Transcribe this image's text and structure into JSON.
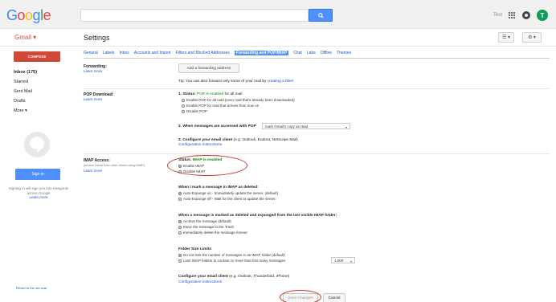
{
  "topbar": {
    "logo": [
      "G",
      "o",
      "o",
      "g",
      "l",
      "e"
    ],
    "logo_colors": [
      "#4285f4",
      "#ea4335",
      "#fbbc05",
      "#4285f4",
      "#34a853",
      "#ea4335"
    ],
    "user_text": "Test",
    "avatar_initial": "T"
  },
  "subbar": {
    "gmail_label": "Gmail ▾",
    "page_title": "Settings",
    "density_icon": "☰ ▾",
    "gear_icon": "⚙ ▾"
  },
  "sidebar": {
    "compose_label": "COMPOSE",
    "items": [
      "Inbox (175)",
      "Starred",
      "Sent Mail",
      "Drafts",
      "More ▾"
    ],
    "signin_label": "Sign in",
    "hangout_note": "Signing in will sign you into Hangouts across Google",
    "learn_more": "Learn more",
    "revert_link": "Revert to the old chat"
  },
  "tabs": [
    "General",
    "Labels",
    "Inbox",
    "Accounts and Import",
    "Filters and Blocked Addresses",
    "Forwarding and POP/IMAP",
    "Chat",
    "Labs",
    "Offline",
    "Themes"
  ],
  "active_tab_index": 5,
  "forwarding": {
    "label": "Forwarding:",
    "learn_more": "Learn more",
    "add_button": "Add a forwarding address",
    "tip_prefix": "Tip: You can also forward only some of your mail by",
    "tip_link": "creating a filter!"
  },
  "pop": {
    "label": "POP Download:",
    "learn_more": "Learn more",
    "status_prefix": "1. Status:",
    "status_value": "POP is enabled",
    "status_suffix": "for all mail",
    "options": [
      "Enable POP for all mail (even mail that's already been downloaded)",
      "Enable POP for mail that arrives from now on",
      "Disable POP"
    ],
    "step2": "2. When messages are accessed with POP",
    "step2_select": "mark Gmail's copy as read",
    "step3_prefix": "3. Configure your email client",
    "step3_suffix": "(e.g. Outlook, Eudora, Netscape Mail)",
    "config_link": "Configuration instructions"
  },
  "imap": {
    "label": "IMAP Access:",
    "sub": "(access Gmail from other clients using IMAP)",
    "learn_more": "Learn more",
    "status_prefix": "Status:",
    "status_value": "IMAP is enabled",
    "options": [
      "Enable IMAP",
      "Disable IMAP"
    ],
    "deleted_title": "When I mark a message in IMAP as deleted:",
    "deleted_options": [
      "Auto-Expunge on - Immediately update the server. (default)",
      "Auto-Expunge off - Wait for the client to update the server."
    ],
    "expunged_title": "When a message is marked as deleted and expunged from the last visible IMAP folder:",
    "expunged_options": [
      "Archive the message (default)",
      "Move the message to the Trash",
      "Immediately delete the message forever"
    ],
    "folder_title": "Folder Size Limits",
    "folder_options": [
      "Do not limit the number of messages in an IMAP folder (default)",
      "Limit IMAP folders to contain no more than this many messages"
    ],
    "folder_select": "1,000",
    "config_prefix": "Configure your email client",
    "config_suffix": "(e.g. Outlook, Thunderbird, iPhone)",
    "config_link": "Configuration instructions"
  },
  "footer": {
    "save": "Save Changes",
    "cancel": "Cancel"
  }
}
